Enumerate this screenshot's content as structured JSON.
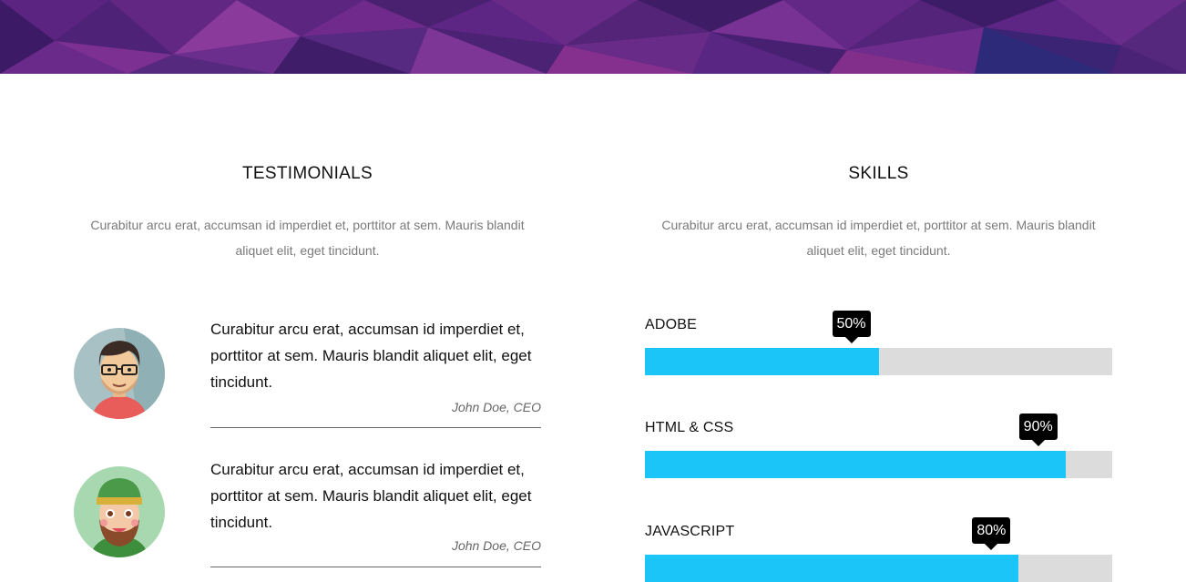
{
  "testimonials": {
    "title": "TESTIMONIALS",
    "description": "Curabitur arcu erat, accumsan id imperdiet et, porttitor at sem. Mauris blandit aliquet elit, eget tincidunt.",
    "items": [
      {
        "quote": "Curabitur arcu erat, accumsan id imperdiet et, porttitor at sem. Mauris blandit aliquet elit, eget tincidunt.",
        "author": "John Doe, CEO",
        "avatar": "man-with-glasses-avatar"
      },
      {
        "quote": "Curabitur arcu erat, accumsan id imperdiet et, porttitor at sem. Mauris blandit aliquet elit, eget tincidunt.",
        "author": "John Doe, CEO",
        "avatar": "bearded-man-with-cap-avatar"
      }
    ]
  },
  "skills": {
    "title": "SKILLS",
    "description": "Curabitur arcu erat, accumsan id imperdiet et, porttitor at sem. Mauris blandit aliquet elit, eget tincidunt.",
    "items": [
      {
        "label": "ADOBE",
        "percent": 50,
        "percent_label": "50%"
      },
      {
        "label": "HTML & CSS",
        "percent": 90,
        "percent_label": "90%"
      },
      {
        "label": "JAVASCRIPT",
        "percent": 80,
        "percent_label": "80%"
      }
    ]
  },
  "colors": {
    "bar_fill": "#1bc5f7",
    "bar_track": "#dcdcdc",
    "tooltip": "#000000",
    "hero": "#4b1d6f"
  }
}
